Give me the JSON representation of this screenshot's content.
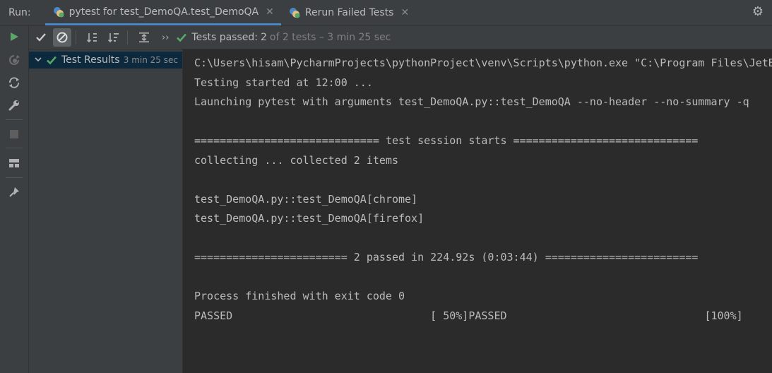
{
  "tabbar": {
    "run_label": "Run:",
    "tabs": [
      {
        "label": "pytest for test_DemoQA.test_DemoQA",
        "icon": "python-test-icon",
        "active": true
      },
      {
        "label": "Rerun Failed Tests",
        "icon": "python-test-icon",
        "active": false
      }
    ],
    "close_glyph": "✕",
    "gear_glyph": "⚙"
  },
  "test_toolbar": {
    "more_glyph": "››",
    "status_passed": "Tests passed:",
    "status_count": "2",
    "status_detail": "of 2 tests – 3 min 25 sec"
  },
  "tree": {
    "root": {
      "label": "Test Results",
      "time": "3 min 25 sec",
      "status": "passed"
    }
  },
  "console": {
    "lines": [
      "C:\\Users\\hisam\\PycharmProjects\\pythonProject\\venv\\Scripts\\python.exe \"C:\\Program Files\\JetBrains",
      "Testing started at 12:00 ...",
      "Launching pytest with arguments test_DemoQA.py::test_DemoQA --no-header --no-summary -q",
      "",
      "============================= test session starts =============================",
      "collecting ... collected 2 items",
      "",
      "test_DemoQA.py::test_DemoQA[chrome]",
      "test_DemoQA.py::test_DemoQA[firefox]",
      "",
      "======================== 2 passed in 224.92s (0:03:44) ========================",
      "",
      "Process finished with exit code 0",
      "PASSED                               [ 50%]PASSED                               [100%]"
    ]
  },
  "colors": {
    "accent_blue": "#4a88c7",
    "pass_green": "#59a869",
    "selection": "#0d293e",
    "panel": "#3c3f41",
    "editor": "#2b2b2b"
  }
}
